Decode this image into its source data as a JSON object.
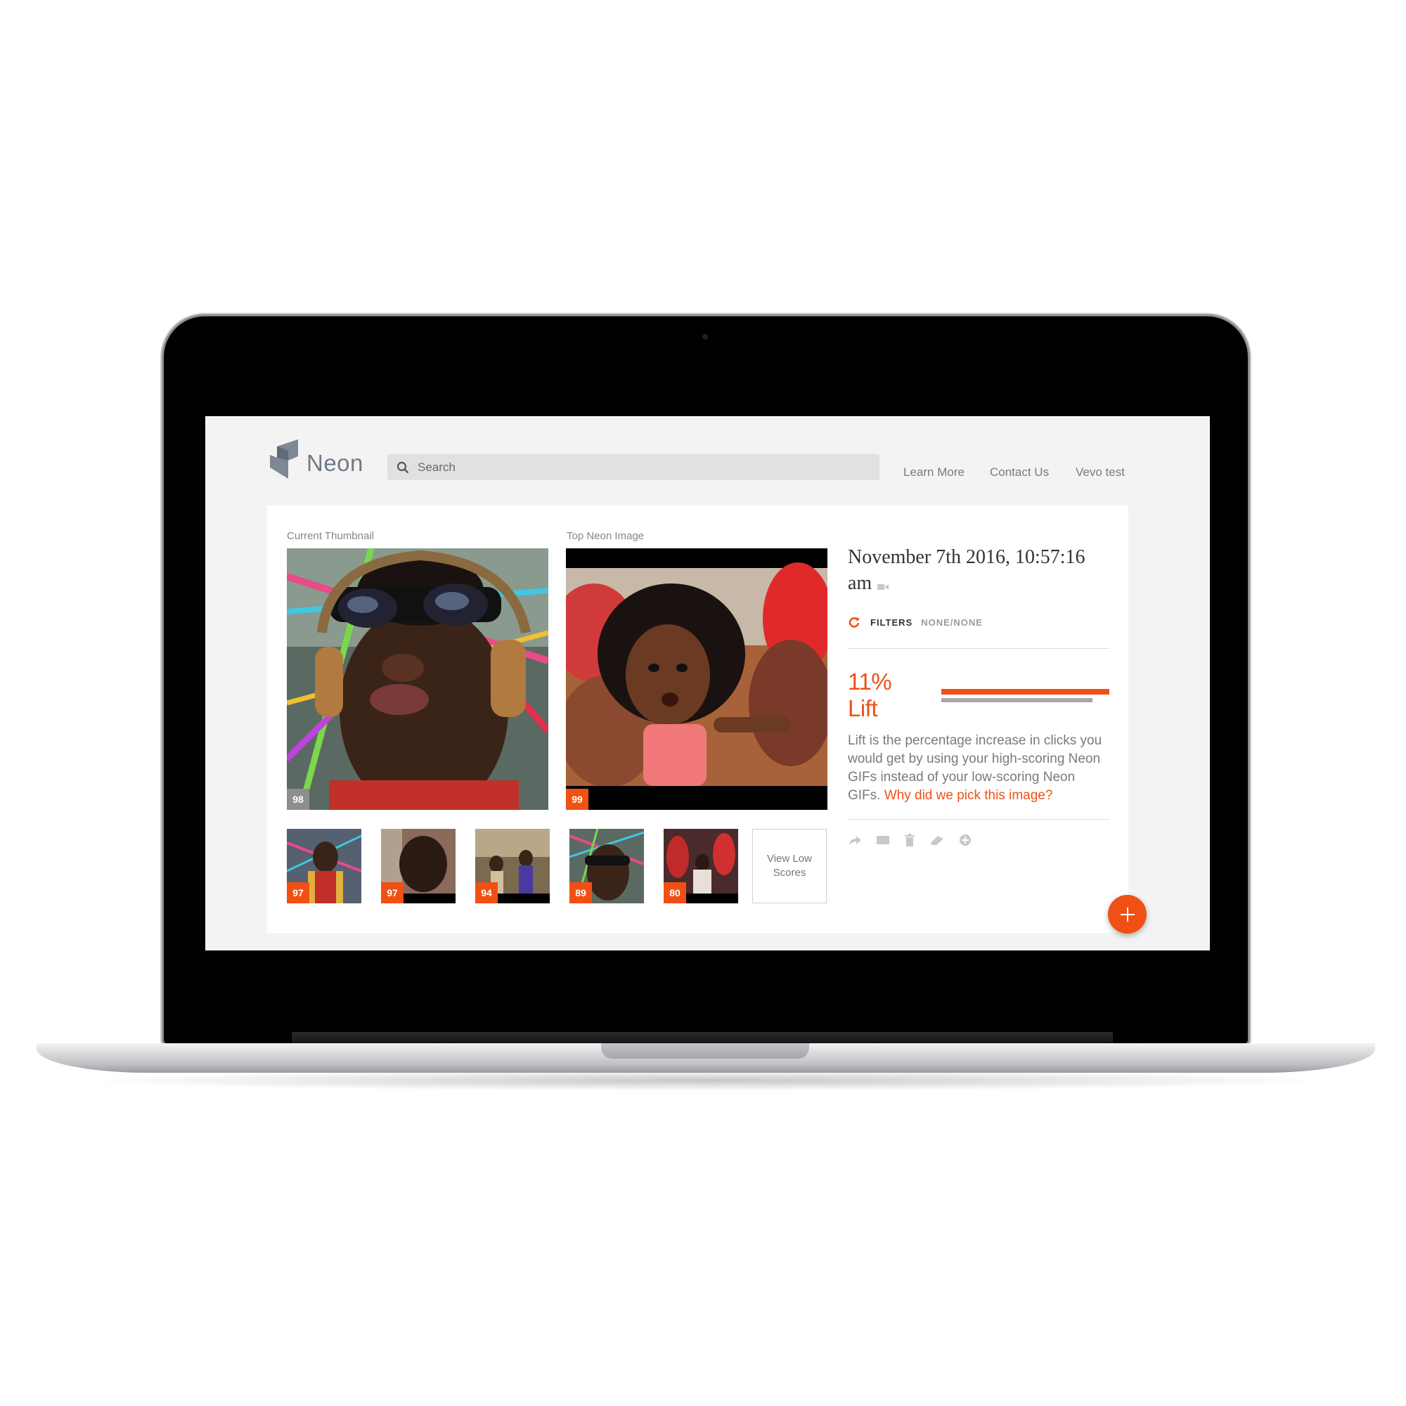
{
  "app": {
    "logo_text": "Neon",
    "brand_color": "#f05014"
  },
  "search": {
    "placeholder": "Search",
    "icon": "search-icon"
  },
  "nav": {
    "learn_more": "Learn More",
    "contact_us": "Contact Us",
    "account": "Vevo test"
  },
  "main": {
    "current_label": "Current Thumbnail",
    "current_score": "98",
    "top_label": "Top Neon Image",
    "top_score": "99",
    "thumbnails": [
      {
        "score": "97"
      },
      {
        "score": "97"
      },
      {
        "score": "94"
      },
      {
        "score": "89"
      },
      {
        "score": "80"
      }
    ],
    "view_low_line1": "View Low",
    "view_low_line2": "Scores"
  },
  "info": {
    "date_line1": "November 7th 2016, 10:57:16",
    "date_line2": "am",
    "filters_label": "FILTERS",
    "filters_value": "NONE/NONE",
    "lift": "11% Lift",
    "description": "Lift is the percentage increase in clicks you would get by using your high-scoring Neon GIFs instead of your low-scoring Neon GIFs.",
    "link": "Why did we pick this image?",
    "actions": [
      "share-icon",
      "email-icon",
      "trash-icon",
      "eraser-icon",
      "add-circle-icon"
    ]
  },
  "fab": {
    "icon": "plus-icon"
  }
}
